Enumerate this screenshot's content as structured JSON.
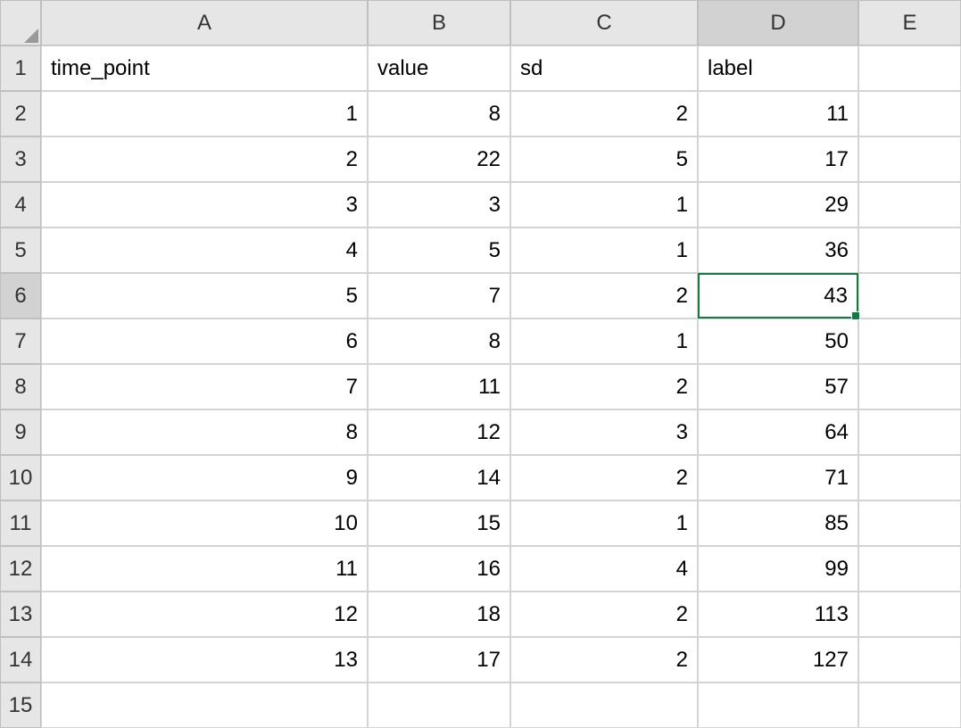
{
  "columns": [
    "A",
    "B",
    "C",
    "D",
    "E"
  ],
  "rows": [
    "1",
    "2",
    "3",
    "4",
    "5",
    "6",
    "7",
    "8",
    "9",
    "10",
    "11",
    "12",
    "13",
    "14",
    "15"
  ],
  "headers": {
    "A": "time_point",
    "B": "value",
    "C": "sd",
    "D": "label"
  },
  "data": [
    {
      "A": "1",
      "B": "8",
      "C": "2",
      "D": "11"
    },
    {
      "A": "2",
      "B": "22",
      "C": "5",
      "D": "17"
    },
    {
      "A": "3",
      "B": "3",
      "C": "1",
      "D": "29"
    },
    {
      "A": "4",
      "B": "5",
      "C": "1",
      "D": "36"
    },
    {
      "A": "5",
      "B": "7",
      "C": "2",
      "D": "43"
    },
    {
      "A": "6",
      "B": "8",
      "C": "1",
      "D": "50"
    },
    {
      "A": "7",
      "B": "11",
      "C": "2",
      "D": "57"
    },
    {
      "A": "8",
      "B": "12",
      "C": "3",
      "D": "64"
    },
    {
      "A": "9",
      "B": "14",
      "C": "2",
      "D": "71"
    },
    {
      "A": "10",
      "B": "15",
      "C": "1",
      "D": "85"
    },
    {
      "A": "11",
      "B": "16",
      "C": "4",
      "D": "99"
    },
    {
      "A": "12",
      "B": "18",
      "C": "2",
      "D": "113"
    },
    {
      "A": "13",
      "B": "17",
      "C": "2",
      "D": "127"
    }
  ],
  "selected_cell": {
    "row": 6,
    "col": "D"
  },
  "active_row": 6,
  "active_col": "D"
}
